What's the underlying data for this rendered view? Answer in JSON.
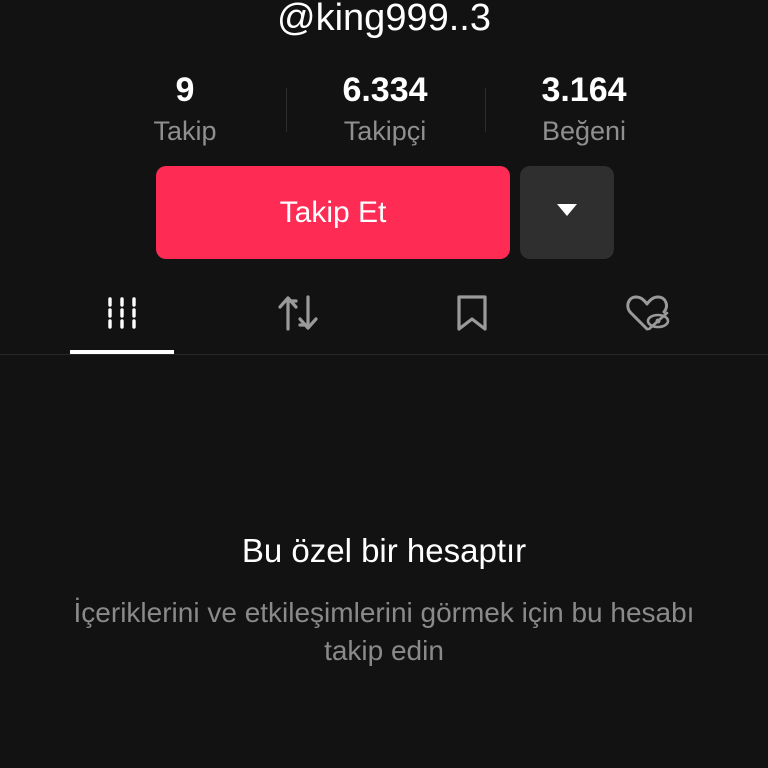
{
  "profile": {
    "username": "@king999..3"
  },
  "stats": [
    {
      "value": "9",
      "label": "Takip"
    },
    {
      "value": "6.334",
      "label": "Takipçi"
    },
    {
      "value": "3.164",
      "label": "Beğeni"
    }
  ],
  "actions": {
    "follow_label": "Takip Et",
    "dropdown_icon": "caret-down-icon"
  },
  "tabs": [
    {
      "icon": "grid-icon",
      "active": true
    },
    {
      "icon": "repost-icon",
      "active": false
    },
    {
      "icon": "bookmark-icon",
      "active": false
    },
    {
      "icon": "liked-hidden-icon",
      "active": false
    }
  ],
  "private_notice": {
    "title": "Bu özel bir hesaptır",
    "description": "İçeriklerini ve etkileşimlerini görmek için bu hesabı takip edin"
  },
  "colors": {
    "background": "#121212",
    "accent": "#fe2c55",
    "secondary_button": "#2f2f2f",
    "muted_text": "#8a8a8a"
  }
}
